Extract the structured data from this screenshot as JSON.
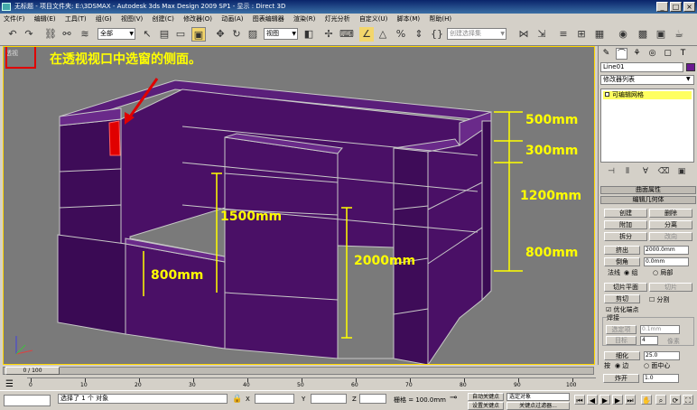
{
  "titlebar": {
    "text": "无标题    - 项目文件夹: E:\\3DSMAX    - Autodesk 3ds Max Design 2009 SP1    - 显示 : Direct 3D"
  },
  "menu": [
    "文件(F)",
    "编辑(E)",
    "工具(T)",
    "组(G)",
    "视图(V)",
    "创建(C)",
    "修改器(O)",
    "动画(A)",
    "图表编辑器",
    "渲染(R)",
    "灯光分析",
    "自定义(U)",
    "脚本(M)",
    "帮助(H)"
  ],
  "toolbar": {
    "filter_value": "全部",
    "refcoord_value": "视图",
    "named_sel_placeholder": "创建选择集"
  },
  "viewport": {
    "label": "透视",
    "annotation": "在透视视口中选窗的侧面。",
    "dims": {
      "d500": "500mm",
      "d300": "300mm",
      "d1200": "1200mm",
      "d800r": "800mm",
      "d1500": "1500mm",
      "d2000": "2000mm",
      "d800l": "800mm"
    },
    "colors": {
      "wall": "#4a1066",
      "selected": "#e00000",
      "text": "#ffff00"
    }
  },
  "cmdpanel": {
    "object_name": "Line01",
    "modifier_list": "修改器列表",
    "stack_item": "可编辑网格",
    "rollout_surface": "曲面属性",
    "rollout_geometry": "编辑几何体",
    "btn_create": "创建",
    "btn_delete": "删除",
    "btn_attach": "附加",
    "btn_detach": "分离",
    "btn_split": "拆分",
    "btn_turn": "改向",
    "extrude_label": "挤出",
    "extrude_value": "2000.0mm",
    "bevel_label": "倒角",
    "bevel_value": "0.0mm",
    "normal_label": "法线",
    "normal_group": "组",
    "normal_local": "局部",
    "btn_slice_plane": "切片平面",
    "btn_slice": "切片",
    "btn_cut": "剪切",
    "split_label": "分割",
    "refine_label": "优化端点",
    "weld_title": "焊接",
    "btn_selected": "选定项",
    "selected_value": "0.1mm",
    "btn_target": "目标",
    "target_value": "4",
    "pixels_label": "像素",
    "btn_tessellate": "细化",
    "tess_value": "25.0",
    "by_label": "按",
    "edge_label": "边",
    "facecenter_label": "面中心",
    "btn_explode": "炸开",
    "explode_value": "1.0"
  },
  "time": {
    "slider_label": "0 / 100",
    "ticks": [
      "0",
      "10",
      "20",
      "30",
      "40",
      "50",
      "60",
      "70",
      "80",
      "90",
      "100"
    ]
  },
  "status": {
    "selection_text": "选择了 1 个 对象",
    "x_label": "X",
    "y_label": "Y",
    "z_label": "Z",
    "grid_text": "栅格 = 100.0mm",
    "autokey": "自动关键点",
    "set_key_dropdown": "选定对象",
    "set_key_label": "设置关键点",
    "key_filters": "关键点过滤器..."
  }
}
